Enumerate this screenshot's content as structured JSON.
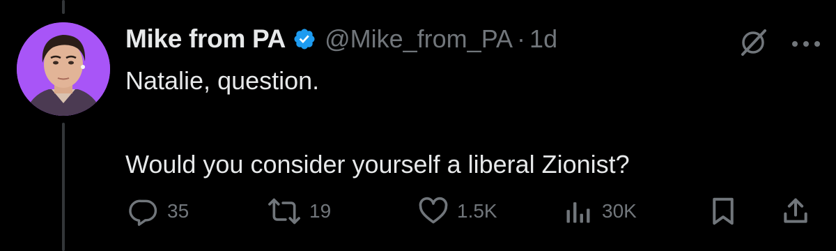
{
  "tweet": {
    "author": {
      "display_name": "Mike from PA",
      "handle": "@Mike_from_PA",
      "verified_icon": "verified-badge-icon",
      "avatar_color": "#a855f7"
    },
    "separator": "·",
    "time": "1d",
    "text_line1": "Natalie, question.",
    "text_line2": "Would you consider yourself a liberal Zionist?",
    "header_icons": [
      "grok-icon",
      "more-icon"
    ]
  },
  "actions": {
    "reply": {
      "icon": "reply-icon",
      "count": "35"
    },
    "repost": {
      "icon": "repost-icon",
      "count": "19"
    },
    "like": {
      "icon": "heart-icon",
      "count": "1.5K"
    },
    "views": {
      "icon": "views-icon",
      "count": "30K"
    },
    "bookmark": {
      "icon": "bookmark-icon"
    },
    "share": {
      "icon": "share-icon"
    }
  },
  "colors": {
    "background": "#000000",
    "text_primary": "#e7e9ea",
    "text_secondary": "#71767b",
    "verified_blue": "#1d9bf0",
    "thread_line": "#333639"
  }
}
